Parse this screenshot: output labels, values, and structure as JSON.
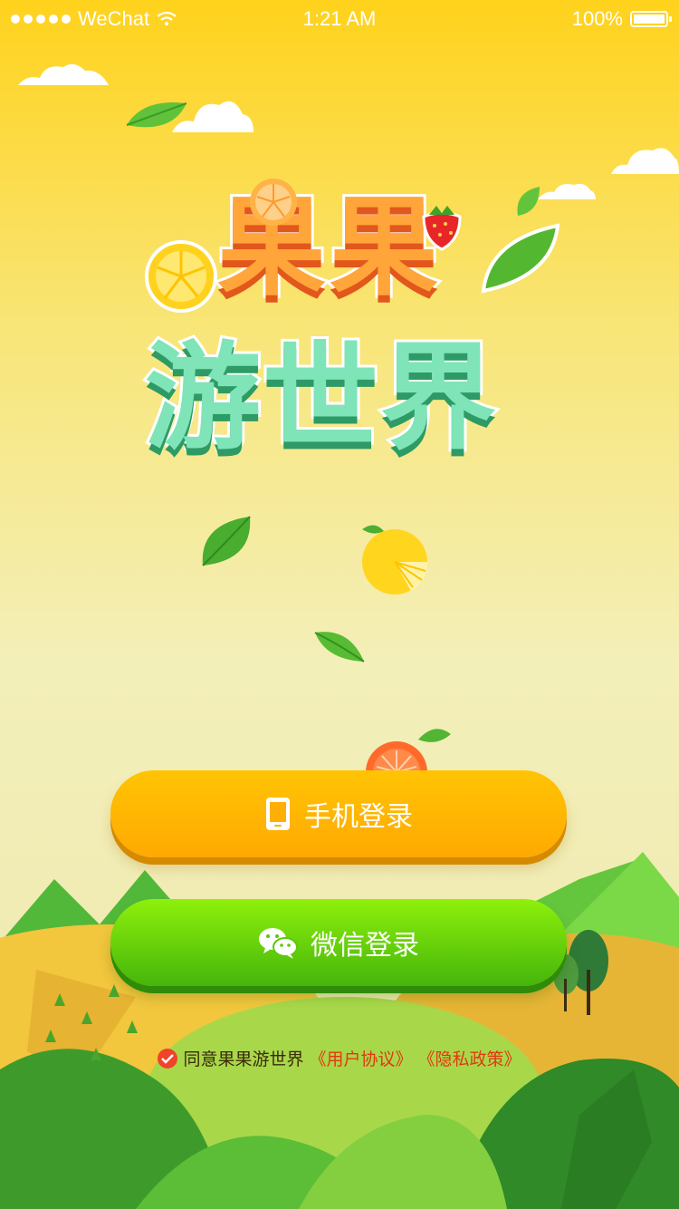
{
  "status_bar": {
    "carrier": "WeChat",
    "time": "1:21 AM",
    "battery": "100%"
  },
  "logo": {
    "line1": "果果",
    "line2": "游世界"
  },
  "buttons": {
    "phone_login": "手机登录",
    "wechat_login": "微信登录"
  },
  "agreement": {
    "text": "同意果果游世界",
    "user_agreement": "《用户协议》",
    "privacy_policy": "《隐私政策》",
    "checked": true
  },
  "colors": {
    "phone_button": "#ffb602",
    "wechat_button": "#6ad40b",
    "link": "#e2380f"
  }
}
